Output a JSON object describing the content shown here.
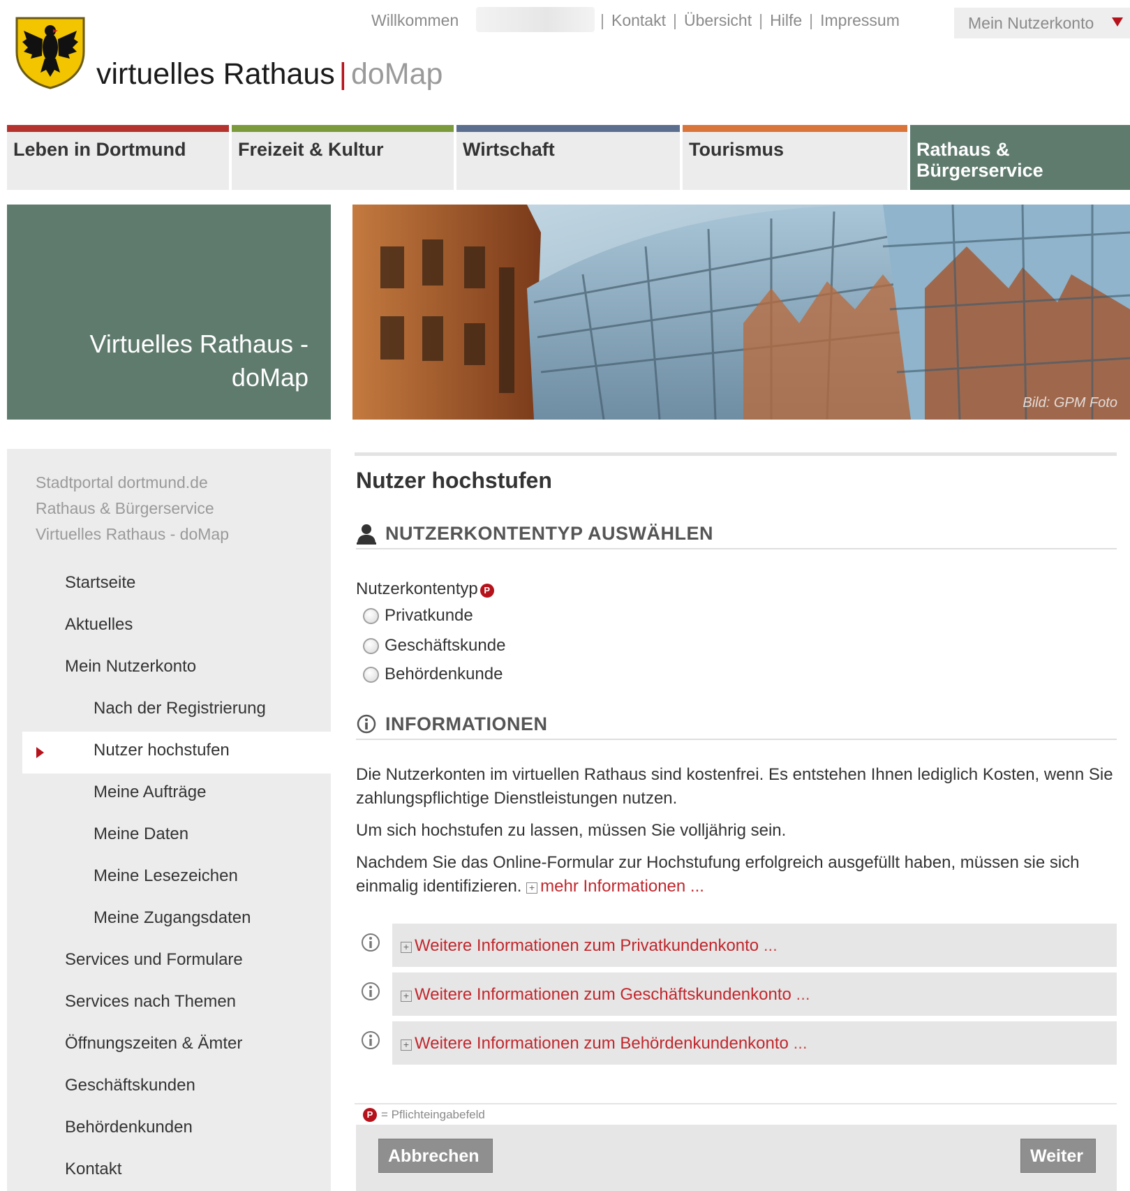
{
  "topbar": {
    "welcome": "Willkommen",
    "links": [
      "Kontakt",
      "Übersicht",
      "Hilfe",
      "Impressum"
    ],
    "account_button": "Mein Nutzerkonto"
  },
  "brand": {
    "name": "virtuelles Rathaus",
    "separator": "|",
    "sub": "doMap"
  },
  "main_nav": [
    {
      "label": "Leben in Dortmund",
      "color": "#b5332e"
    },
    {
      "label": "Freizeit & Kultur",
      "color": "#7a9a3c"
    },
    {
      "label": "Wirtschaft",
      "color": "#5b6e8e"
    },
    {
      "label": "Tourismus",
      "color": "#d9743a"
    },
    {
      "label": "Rathaus & Bürgerservice",
      "color": "#5f7b6e"
    }
  ],
  "hero": {
    "title": "Virtuelles Rathaus - doMap",
    "credit": "Bild: GPM Foto"
  },
  "sidebar": {
    "breadcrumbs": [
      "Stadtportal dortmund.de",
      "Rathaus & Bürgerservice",
      "Virtuelles Rathaus - doMap"
    ],
    "items": [
      {
        "label": "Startseite",
        "level": 1
      },
      {
        "label": "Aktuelles",
        "level": 1
      },
      {
        "label": "Mein Nutzerkonto",
        "level": 1
      },
      {
        "label": "Nach der Registrierung",
        "level": 2
      },
      {
        "label": "Nutzer hochstufen",
        "level": 2,
        "current": true
      },
      {
        "label": "Meine Aufträge",
        "level": 2
      },
      {
        "label": "Meine Daten",
        "level": 2
      },
      {
        "label": "Meine Lesezeichen",
        "level": 2
      },
      {
        "label": "Meine Zugangsdaten",
        "level": 2
      },
      {
        "label": "Services und Formulare",
        "level": 1
      },
      {
        "label": "Services nach Themen",
        "level": 1
      },
      {
        "label": "Öffnungszeiten & Ämter",
        "level": 1
      },
      {
        "label": "Geschäftskunden",
        "level": 1
      },
      {
        "label": "Behördenkunden",
        "level": 1
      },
      {
        "label": "Kontakt",
        "level": 1
      }
    ]
  },
  "content": {
    "title": "Nutzer hochstufen",
    "section1": "NUTZERKONTENTYP AUSWÄHLEN",
    "field_label": "Nutzerkontentyp",
    "options": [
      "Privatkunde",
      "Geschäftskunde",
      "Behördenkunde"
    ],
    "section2": "INFORMATIONEN",
    "para1": "Die Nutzerkonten im virtuellen Rathaus sind kostenfrei. Es entstehen Ihnen lediglich Kosten, wenn Sie zahlungspflichtige Dienstleistungen nutzen.",
    "para2": "Um sich hochstufen zu lassen, müssen Sie volljährig sein.",
    "para3": "Nachdem Sie das Online-Formular zur Hochstufung erfolgreich ausgefüllt haben, müssen sie sich einmalig identifizieren.",
    "more_link": "mehr Informationen",
    "ellipsis": "...",
    "accordions": [
      "Weitere Informationen zum Privatkundenkonto",
      "Weitere Informationen zum Geschäftskundenkonto",
      "Weitere Informationen zum Behördenkundenkonto"
    ],
    "required_note": "= Pflichteingabefeld",
    "cancel": "Abbrechen",
    "next": "Weiter"
  },
  "colors": {
    "accent": "#b5121b",
    "green": "#5f7b6e",
    "link": "#c1272d"
  }
}
